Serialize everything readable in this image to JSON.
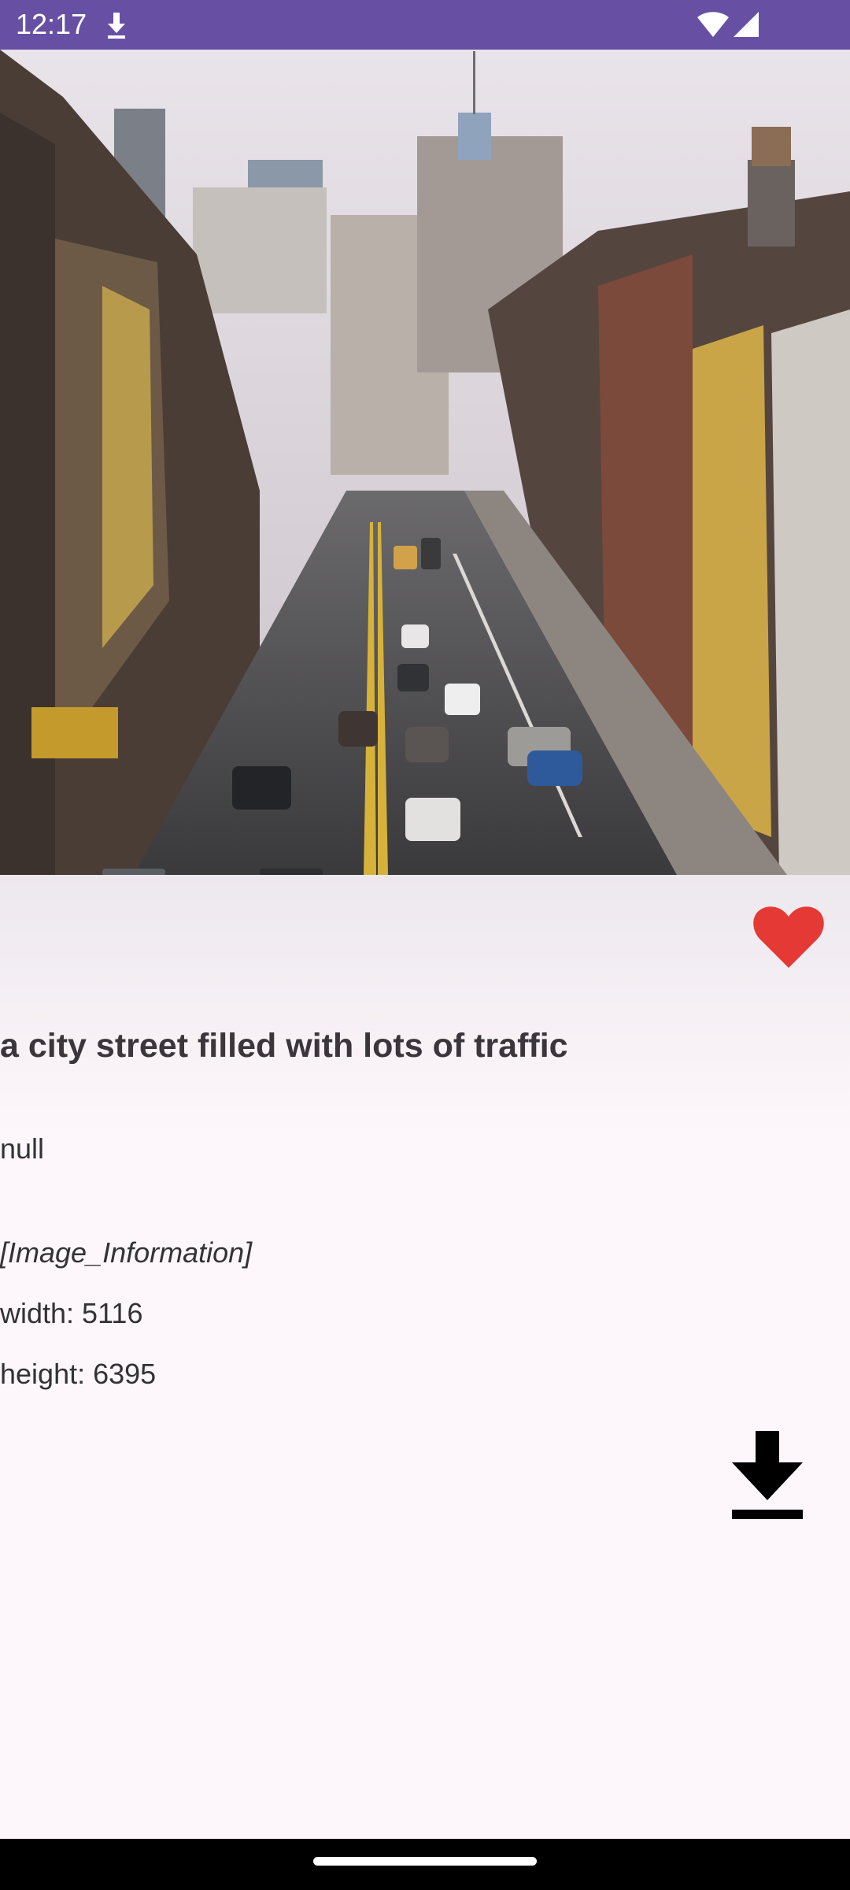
{
  "status_bar": {
    "time": "12:17",
    "icons": [
      "download-icon",
      "wifi-icon",
      "signal-icon"
    ],
    "background": "#6750a4"
  },
  "hero_image": {
    "subject": "city street with traffic"
  },
  "favorite": {
    "icon": "heart-icon",
    "color": "#e53935",
    "state": "favorited"
  },
  "photo": {
    "title": "a city street filled with lots of traffic",
    "description": "null",
    "info_header": "[Image_Information]",
    "width_text": "width: 5116",
    "height_text": "height: 6395"
  },
  "download": {
    "icon": "download-icon"
  }
}
